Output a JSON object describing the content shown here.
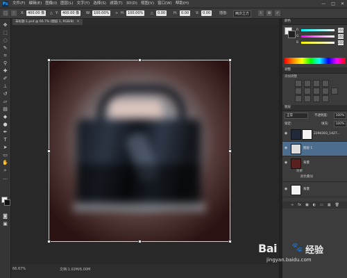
{
  "app": {
    "logo": "Ps"
  },
  "menu": {
    "items": [
      "文件(F)",
      "编辑(E)",
      "图像(I)",
      "图层(L)",
      "文字(Y)",
      "选择(S)",
      "滤镜(T)",
      "3D(D)",
      "视图(V)",
      "窗口(W)",
      "帮助(H)"
    ],
    "window_controls": [
      "—",
      "□",
      "✕"
    ]
  },
  "options": {
    "x": "400.00 像",
    "y": "400.00 像",
    "w": "100.00%",
    "h": "100.00%",
    "angle": "0.00",
    "hskew": "0.00",
    "vskew": "0.00",
    "interpolation": "两次立方",
    "labels": {
      "x": "X:",
      "y": "Y:",
      "w": "W:",
      "h": "H:",
      "angle": "△",
      "h_skew": "H:",
      "v_skew": "V:",
      "interp": "插值:"
    }
  },
  "document": {
    "tab_title": "未标题-1.psd @ 66.7% (图层 1, RGB/8)",
    "tab_close": "×",
    "zoom": "66.67%",
    "size_info": "文档:1.02M/6.00M"
  },
  "colors": {
    "accent": "#4d6d8f",
    "background": "#282828",
    "panel": "#3c3c3c",
    "canvas_bg": "#2a1312"
  },
  "panels": {
    "color": {
      "title": "颜色",
      "sliders": [
        {
          "label": "R",
          "value": "255",
          "color": "#e0e0e0"
        },
        {
          "label": "G",
          "value": "255",
          "color": "#e0e0e0"
        },
        {
          "label": "B",
          "value": "255",
          "color": "#e0e0e0"
        }
      ]
    },
    "adjustments": {
      "title": "调整",
      "hint": "添加调整"
    },
    "layers": {
      "title": "图层",
      "blend_mode": "正常",
      "opacity_label": "不透明度:",
      "opacity": "100%",
      "lock_label": "锁定:",
      "fill_label": "填充:",
      "fill": "100%",
      "rows": [
        {
          "name": "图层1",
          "type": "masked",
          "selected": false
        },
        {
          "name": "图层 1",
          "type": "plain",
          "selected": true
        },
        {
          "name": "背景",
          "type": "background",
          "selected": false
        }
      ],
      "subrows": [
        "效果",
        "颜色叠加"
      ],
      "layer3_name": "背景",
      "masked_name": "2294303_1427...",
      "toolbar": [
        "∞",
        "fx",
        "▣",
        "◐",
        "▭",
        "▦",
        "🗑"
      ]
    }
  },
  "watermark": {
    "brand": "Bai",
    "paw": "🐾",
    "cn": "经验",
    "url": "jingyan.baidu.com"
  }
}
